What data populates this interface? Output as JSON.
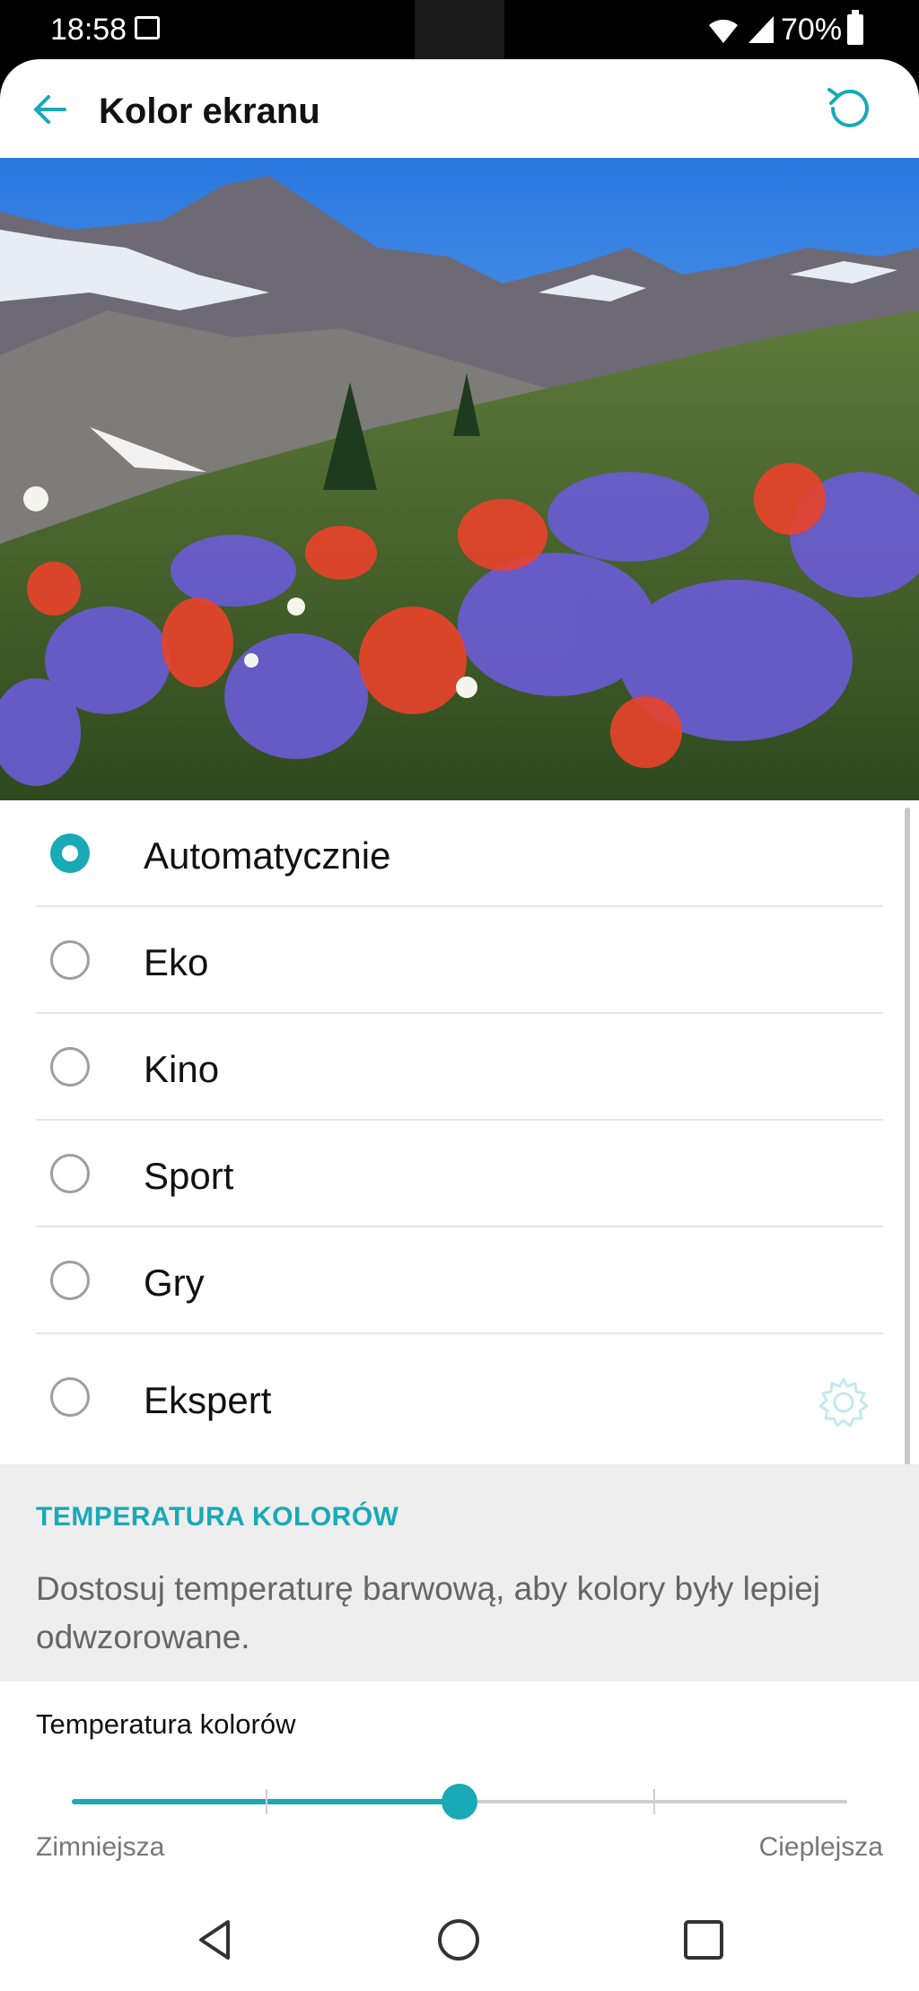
{
  "status_bar": {
    "time": "18:58",
    "battery": "70%",
    "icons": [
      "gallery-icon",
      "wifi-icon",
      "signal-icon",
      "battery-icon"
    ]
  },
  "app_bar": {
    "title": "Kolor ekranu",
    "back_icon": "arrow-left-icon",
    "reset_icon": "reset-icon"
  },
  "colors": {
    "accent": "#1aa9b6",
    "section_bg": "#eeeeee"
  },
  "options": [
    {
      "label": "Automatycznie",
      "checked": true
    },
    {
      "label": "Eko",
      "checked": false
    },
    {
      "label": "Kino",
      "checked": false
    },
    {
      "label": "Sport",
      "checked": false
    },
    {
      "label": "Gry",
      "checked": false
    },
    {
      "label": "Ekspert",
      "checked": false,
      "settings_icon": "gear-icon"
    }
  ],
  "temperature": {
    "section_heading": "TEMPERATURA KOLORÓW",
    "description": "Dostosuj temperaturę barwową, aby kolory były lepiej odwzorowane.",
    "slider_label": "Temperatura kolorów",
    "min_label": "Zimniejsza",
    "max_label": "Cieplejsza",
    "value_fraction": 0.5
  },
  "nav_bar": {
    "icons": [
      "back-triangle-icon",
      "home-circle-icon",
      "recents-square-icon"
    ]
  }
}
